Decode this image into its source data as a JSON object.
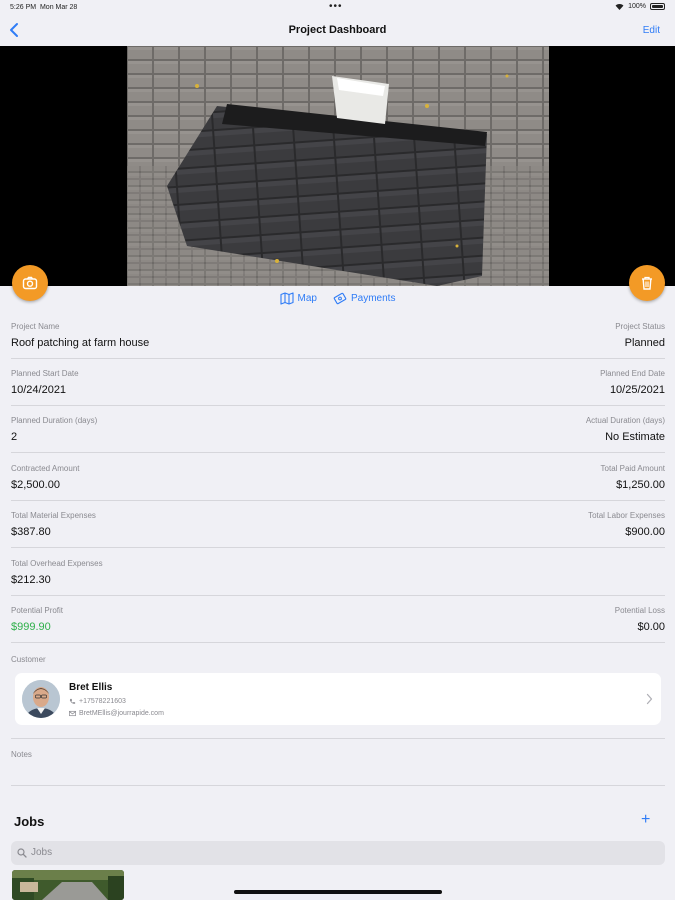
{
  "status_bar": {
    "time": "5:26 PM",
    "date": "Mon Mar 28",
    "dots": "•••",
    "battery": "100%"
  },
  "nav": {
    "title": "Project Dashboard",
    "edit_label": "Edit",
    "back_icon": "chevron-left-icon"
  },
  "actions": {
    "camera_icon": "camera-icon",
    "trash_icon": "trash-icon"
  },
  "links": {
    "map": "Map",
    "payments": "Payments"
  },
  "fields": {
    "project_name_label": "Project Name",
    "project_name": "Roof patching at farm house",
    "project_status_label": "Project Status",
    "project_status": "Planned",
    "planned_start_label": "Planned Start Date",
    "planned_start": "10/24/2021",
    "planned_end_label": "Planned End Date",
    "planned_end": "10/25/2021",
    "planned_duration_label": "Planned Duration (days)",
    "planned_duration": "2",
    "actual_duration_label": "Actual Duration (days)",
    "actual_duration": "No Estimate",
    "contracted_label": "Contracted Amount",
    "contracted": "$2,500.00",
    "total_paid_label": "Total Paid Amount",
    "total_paid": "$1,250.00",
    "material_label": "Total Material Expenses",
    "material": "$387.80",
    "labor_label": "Total Labor Expenses",
    "labor": "$900.00",
    "overhead_label": "Total Overhead Expenses",
    "overhead": "$212.30",
    "profit_label": "Potential Profit",
    "profit": "$999.90",
    "loss_label": "Potential Loss",
    "loss": "$0.00"
  },
  "customer": {
    "label": "Customer",
    "name": "Bret  Ellis",
    "phone": "+17578221603",
    "email": "BretMEllis@jourrapide.com"
  },
  "notes": {
    "label": "Notes"
  },
  "jobs": {
    "title": "Jobs",
    "add_label": "+",
    "search_placeholder": "Jobs"
  },
  "colors": {
    "accent": "#2f7cf6",
    "fab": "#f39a26",
    "profit": "#2fb04b"
  }
}
